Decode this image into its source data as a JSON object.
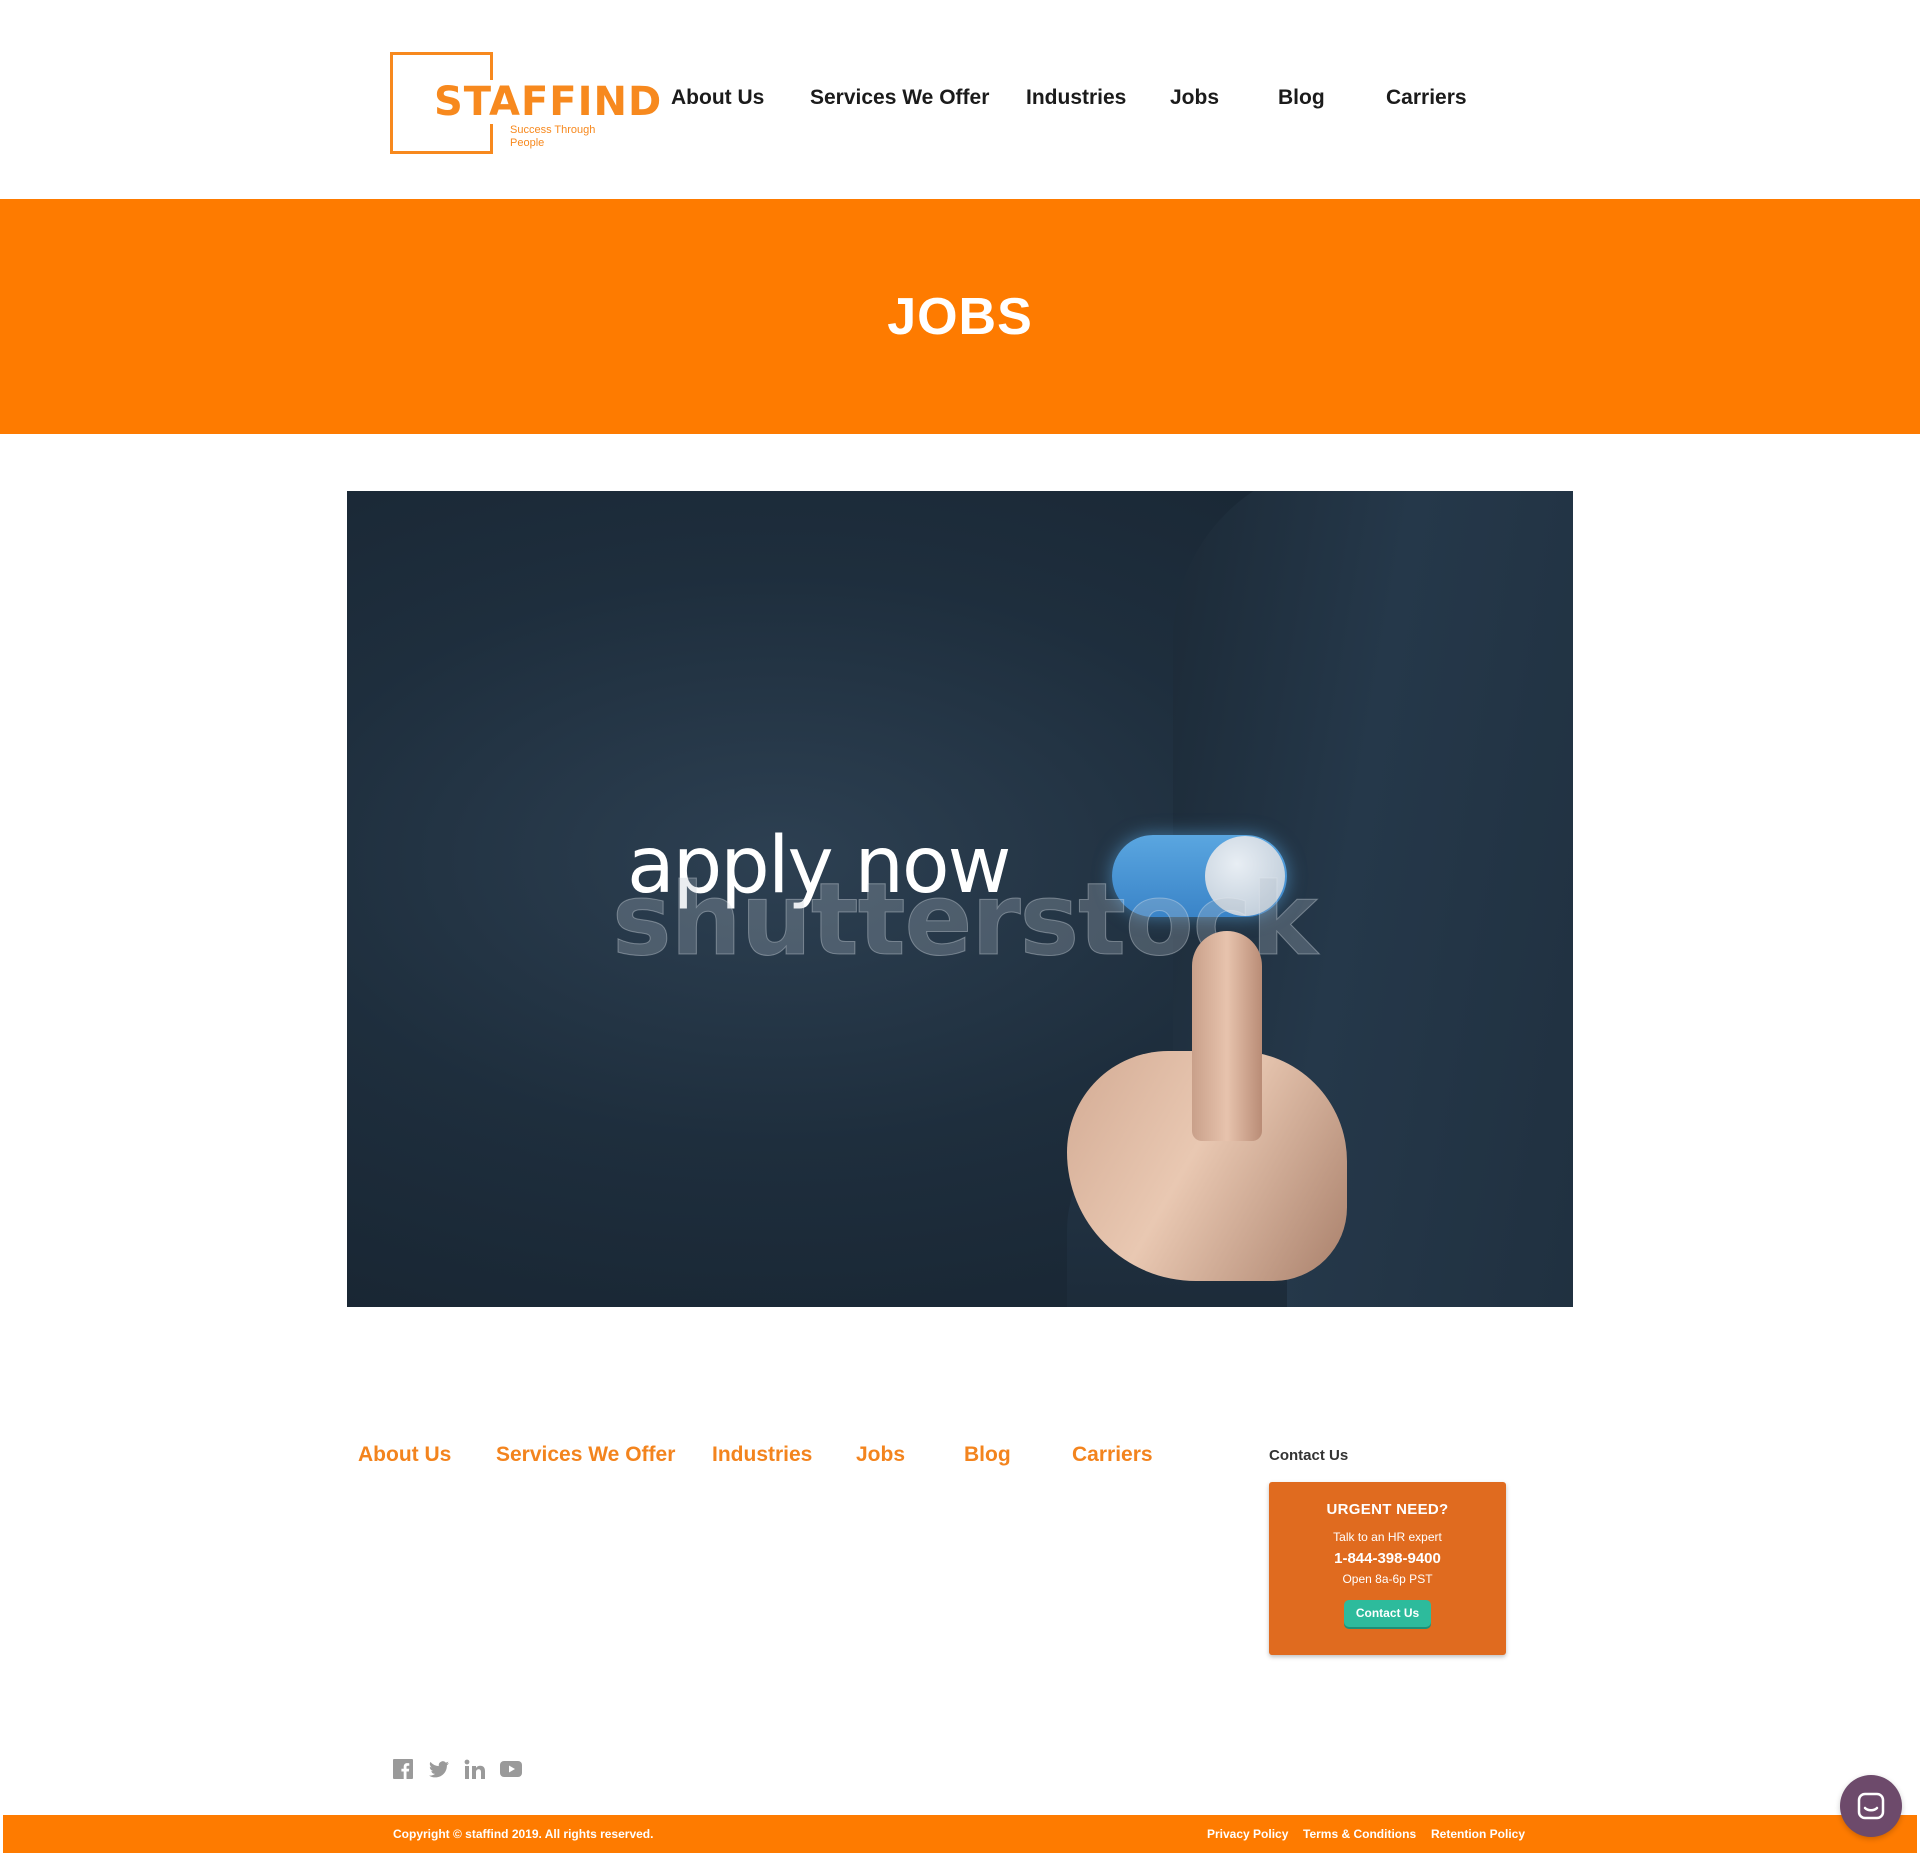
{
  "header": {
    "logo": {
      "name": "STAFFIND",
      "tagline": "Success Through People"
    },
    "nav": [
      {
        "label": "About Us"
      },
      {
        "label": "Services We Offer"
      },
      {
        "label": "Industries"
      },
      {
        "label": "Jobs"
      },
      {
        "label": "Blog"
      },
      {
        "label": "Carriers"
      }
    ]
  },
  "banner": {
    "title": "JOBS"
  },
  "hero": {
    "overlay_text": "apply now",
    "watermark": "shutterstock"
  },
  "footer": {
    "nav": [
      {
        "label": "About Us"
      },
      {
        "label": "Services We Offer"
      },
      {
        "label": "Industries"
      },
      {
        "label": "Jobs"
      },
      {
        "label": "Blog"
      },
      {
        "label": "Carriers"
      }
    ],
    "contact_label": "Contact Us",
    "urgent": {
      "title": "URGENT NEED?",
      "subtitle": "Talk to an HR expert",
      "phone": "1-844-398-9400",
      "hours": "Open 8a-6p PST",
      "button": "Contact Us"
    },
    "social": [
      "facebook-icon",
      "twitter-icon",
      "linkedin-icon",
      "youtube-icon"
    ],
    "copyright": "Copyright © staffind 2019. All rights reserved.",
    "links": [
      {
        "label": "Privacy Policy"
      },
      {
        "label": "Terms & Conditions"
      },
      {
        "label": "Retention Policy"
      }
    ]
  },
  "colors": {
    "accent": "#fe7b00",
    "footer_link": "#f3841e",
    "urgent_bg": "#e06b1f",
    "button": "#2dbb9c",
    "chat": "#6d4a6b"
  }
}
